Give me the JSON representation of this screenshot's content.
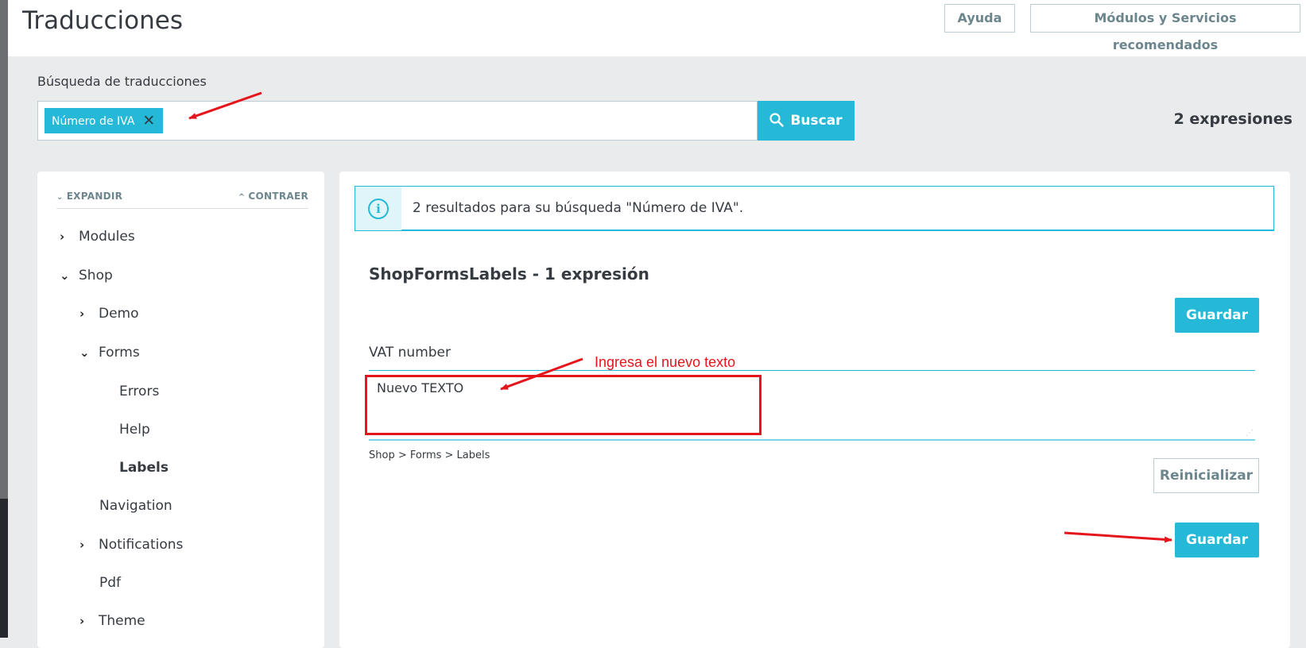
{
  "header": {
    "title": "Traducciones",
    "help_label": "Ayuda",
    "recommended_label": "Módulos y Servicios recomendados"
  },
  "search": {
    "label": "Búsqueda de traducciones",
    "tag": "Número de IVA",
    "button_label": "Buscar",
    "expressions_count": "2 expresiones"
  },
  "sidebar": {
    "expand_label": "EXPANDIR",
    "collapse_label": "CONTRAER",
    "items": [
      {
        "label": "Modules",
        "state": "collapsed"
      },
      {
        "label": "Shop",
        "state": "expanded"
      },
      {
        "label": "Demo",
        "state": "collapsed"
      },
      {
        "label": "Forms",
        "state": "expanded"
      },
      {
        "label": "Errors",
        "state": "leaf"
      },
      {
        "label": "Help",
        "state": "leaf"
      },
      {
        "label": "Labels",
        "state": "active"
      },
      {
        "label": "Navigation",
        "state": "leaf"
      },
      {
        "label": "Notifications",
        "state": "collapsed"
      },
      {
        "label": "Pdf",
        "state": "leaf"
      },
      {
        "label": "Theme",
        "state": "collapsed"
      }
    ]
  },
  "main": {
    "alert_text": "2 resultados para su búsqueda \"Número de IVA\".",
    "section_title": "ShopFormsLabels - 1 expresión",
    "save_label": "Guardar",
    "field_label": "VAT number",
    "field_value": "Nuevo TEXTO",
    "breadcrumb": "Shop > Forms > Labels",
    "reset_label": "Reinicializar"
  },
  "annotation": {
    "text": "Ingresa el nuevo texto",
    "color": "#e5151c"
  },
  "colors": {
    "accent": "#25b9d7",
    "background": "#eaebec",
    "text": "#363a41"
  }
}
